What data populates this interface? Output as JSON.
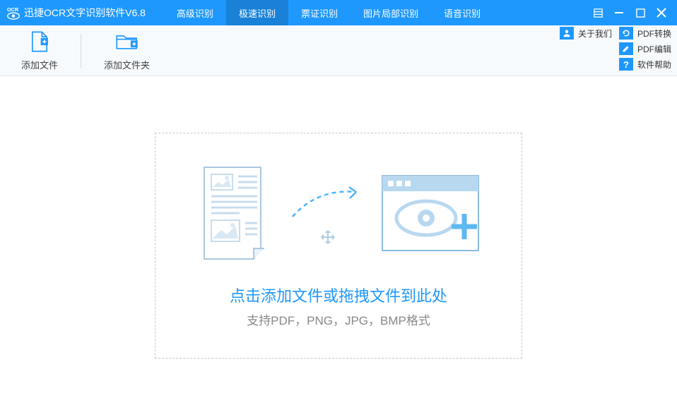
{
  "titlebar": {
    "app_title": "迅捷OCR文字识别软件V6.8",
    "tabs": [
      {
        "label": "高级识别"
      },
      {
        "label": "极速识别"
      },
      {
        "label": "票证识别"
      },
      {
        "label": "图片局部识别"
      },
      {
        "label": "语音识别"
      }
    ]
  },
  "toolbar": {
    "add_file": "添加文件",
    "add_folder": "添加文件夹"
  },
  "sidelinks": {
    "about": "关于我们",
    "pdf_convert": "PDF转换",
    "pdf_edit": "PDF编辑",
    "help": "软件帮助"
  },
  "dropzone": {
    "title": "点击添加文件或拖拽文件到此处",
    "sub": "支持PDF，PNG，JPG，BMP格式"
  }
}
